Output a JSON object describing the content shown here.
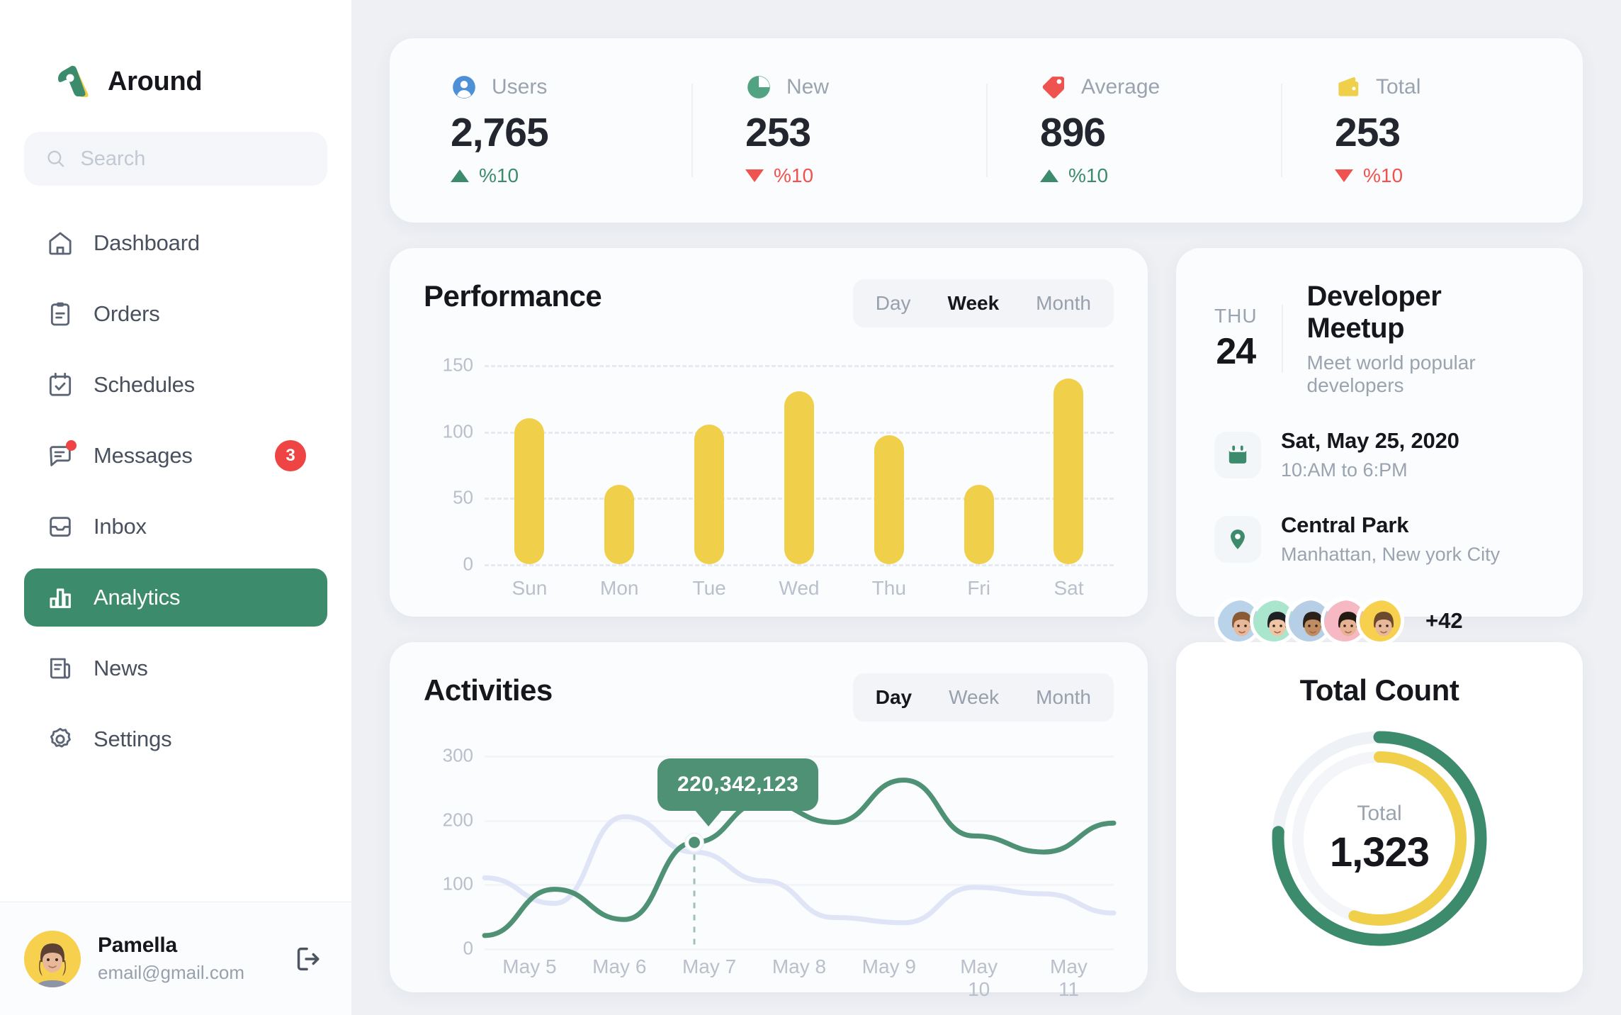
{
  "brand": {
    "name": "Around"
  },
  "search": {
    "placeholder": "Search",
    "value": ""
  },
  "sidebar": {
    "items": [
      {
        "label": "Dashboard",
        "icon": "home-icon",
        "active": false,
        "badge": ""
      },
      {
        "label": "Orders",
        "icon": "clipboard-icon",
        "active": false,
        "badge": ""
      },
      {
        "label": "Schedules",
        "icon": "calendar-check-icon",
        "active": false,
        "badge": ""
      },
      {
        "label": "Messages",
        "icon": "chat-icon",
        "active": false,
        "badge": "3"
      },
      {
        "label": "Inbox",
        "icon": "inbox-icon",
        "active": false,
        "badge": ""
      },
      {
        "label": "Analytics",
        "icon": "bar-chart-icon",
        "active": true,
        "badge": ""
      },
      {
        "label": "News",
        "icon": "news-icon",
        "active": false,
        "badge": ""
      },
      {
        "label": "Settings",
        "icon": "gear-icon",
        "active": false,
        "badge": ""
      }
    ]
  },
  "profile": {
    "name": "Pamella",
    "email": "email@gmail.com",
    "logout_icon": "logout-icon"
  },
  "stats": [
    {
      "label": "Users",
      "value": "2,765",
      "delta": "%10",
      "direction": "up",
      "icon": "user-circle-icon",
      "color": "#4d90d8"
    },
    {
      "label": "New",
      "value": "253",
      "delta": "%10",
      "direction": "down",
      "icon": "pie-chart-icon",
      "color": "#52a382"
    },
    {
      "label": "Average",
      "value": "896",
      "delta": "%10",
      "direction": "up",
      "icon": "tag-icon",
      "color": "#ef5350"
    },
    {
      "label": "Total",
      "value": "253",
      "delta": "%10",
      "direction": "down",
      "icon": "wallet-icon",
      "color": "#f0cf4b"
    }
  ],
  "performance": {
    "title": "Performance",
    "tabs": [
      {
        "label": "Day",
        "active": false
      },
      {
        "label": "Week",
        "active": true
      },
      {
        "label": "Month",
        "active": false
      }
    ]
  },
  "activities": {
    "title": "Activities",
    "tabs": [
      {
        "label": "Day",
        "active": true
      },
      {
        "label": "Week",
        "active": false
      },
      {
        "label": "Month",
        "active": false
      }
    ],
    "tooltip": "220,342,123"
  },
  "meetup": {
    "dow": "THU",
    "day": "24",
    "title": "Developer Meetup",
    "subtitle": "Meet world popular developers",
    "date": "Sat, May 25, 2020",
    "time": "10:AM to 6:PM",
    "place": "Central Park",
    "address": "Manhattan, New york City",
    "date_icon": "calendar-icon",
    "place_icon": "map-pin-icon",
    "more_attendees": "+42",
    "attendee_colors": [
      "#b9d3ea",
      "#a9e6cd",
      "#b6cfe6",
      "#f6b9c4",
      "#f7d14e"
    ]
  },
  "total_count": {
    "title": "Total Count",
    "center_label": "Total",
    "center_value": "1,323"
  },
  "chart_data": [
    {
      "type": "bar",
      "title": "Performance",
      "categories": [
        "Sun",
        "Mon",
        "Tue",
        "Wed",
        "Thu",
        "Fri",
        "Sat"
      ],
      "values": [
        110,
        60,
        105,
        130,
        97,
        60,
        140
      ],
      "ylabel": "",
      "xlabel": "",
      "yticks": [
        0,
        50,
        100,
        150
      ],
      "ylim": [
        0,
        160
      ],
      "grid": true,
      "color": "#f0cf4b"
    },
    {
      "type": "line",
      "title": "Activities",
      "x": [
        "May 5",
        "May 6",
        "May 7",
        "May 8",
        "May 9",
        "May 10",
        "May 11"
      ],
      "yticks": [
        0,
        100,
        200,
        300
      ],
      "ylim": [
        0,
        320
      ],
      "grid": true,
      "annotation": {
        "label": "220,342,123",
        "x_index": 3,
        "y": 165
      },
      "series": [
        {
          "name": "primary",
          "color": "#4f9174",
          "values": [
            20,
            92,
            45,
            165,
            228,
            196,
            262,
            175,
            150,
            195
          ]
        },
        {
          "name": "secondary",
          "color": "#dfe5f7",
          "values": [
            110,
            70,
            205,
            150,
            105,
            48,
            40,
            95,
            85,
            55
          ]
        }
      ]
    },
    {
      "type": "pie",
      "title": "Total Count",
      "center_label": "Total",
      "center_value": "1,323",
      "rings": [
        {
          "name": "outer",
          "percent": 76,
          "color": "#3d8b6d",
          "track": "#eef1f5"
        },
        {
          "name": "inner",
          "percent": 55,
          "color": "#f0cf4b",
          "track": "#f3f5f8"
        }
      ]
    }
  ]
}
